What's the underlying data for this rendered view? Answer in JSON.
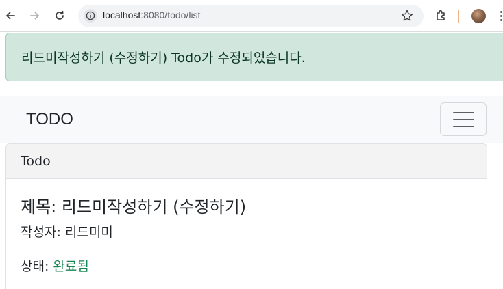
{
  "browser": {
    "url_host": "localhost",
    "url_rest": ":8080/todo/list"
  },
  "alert": {
    "message": "리드미작성하기 (수정하기) Todo가 수정되었습니다.",
    "color": "#d1e7dd"
  },
  "navbar": {
    "brand": "TODO"
  },
  "card": {
    "header": "Todo",
    "title_label": "제목: ",
    "title_value": "리드미작성하기 (수정하기)",
    "writer_label": "작성자: ",
    "writer_value": "리드미미",
    "status_label": "상태: ",
    "status_value": "완료됨",
    "status_color": "#198754"
  },
  "icons": [
    "back-arrow-icon",
    "forward-arrow-icon",
    "reload-icon",
    "site-info-icon",
    "star-icon",
    "extensions-icon",
    "profile-avatar",
    "kebab-menu-icon",
    "hamburger-icon"
  ]
}
